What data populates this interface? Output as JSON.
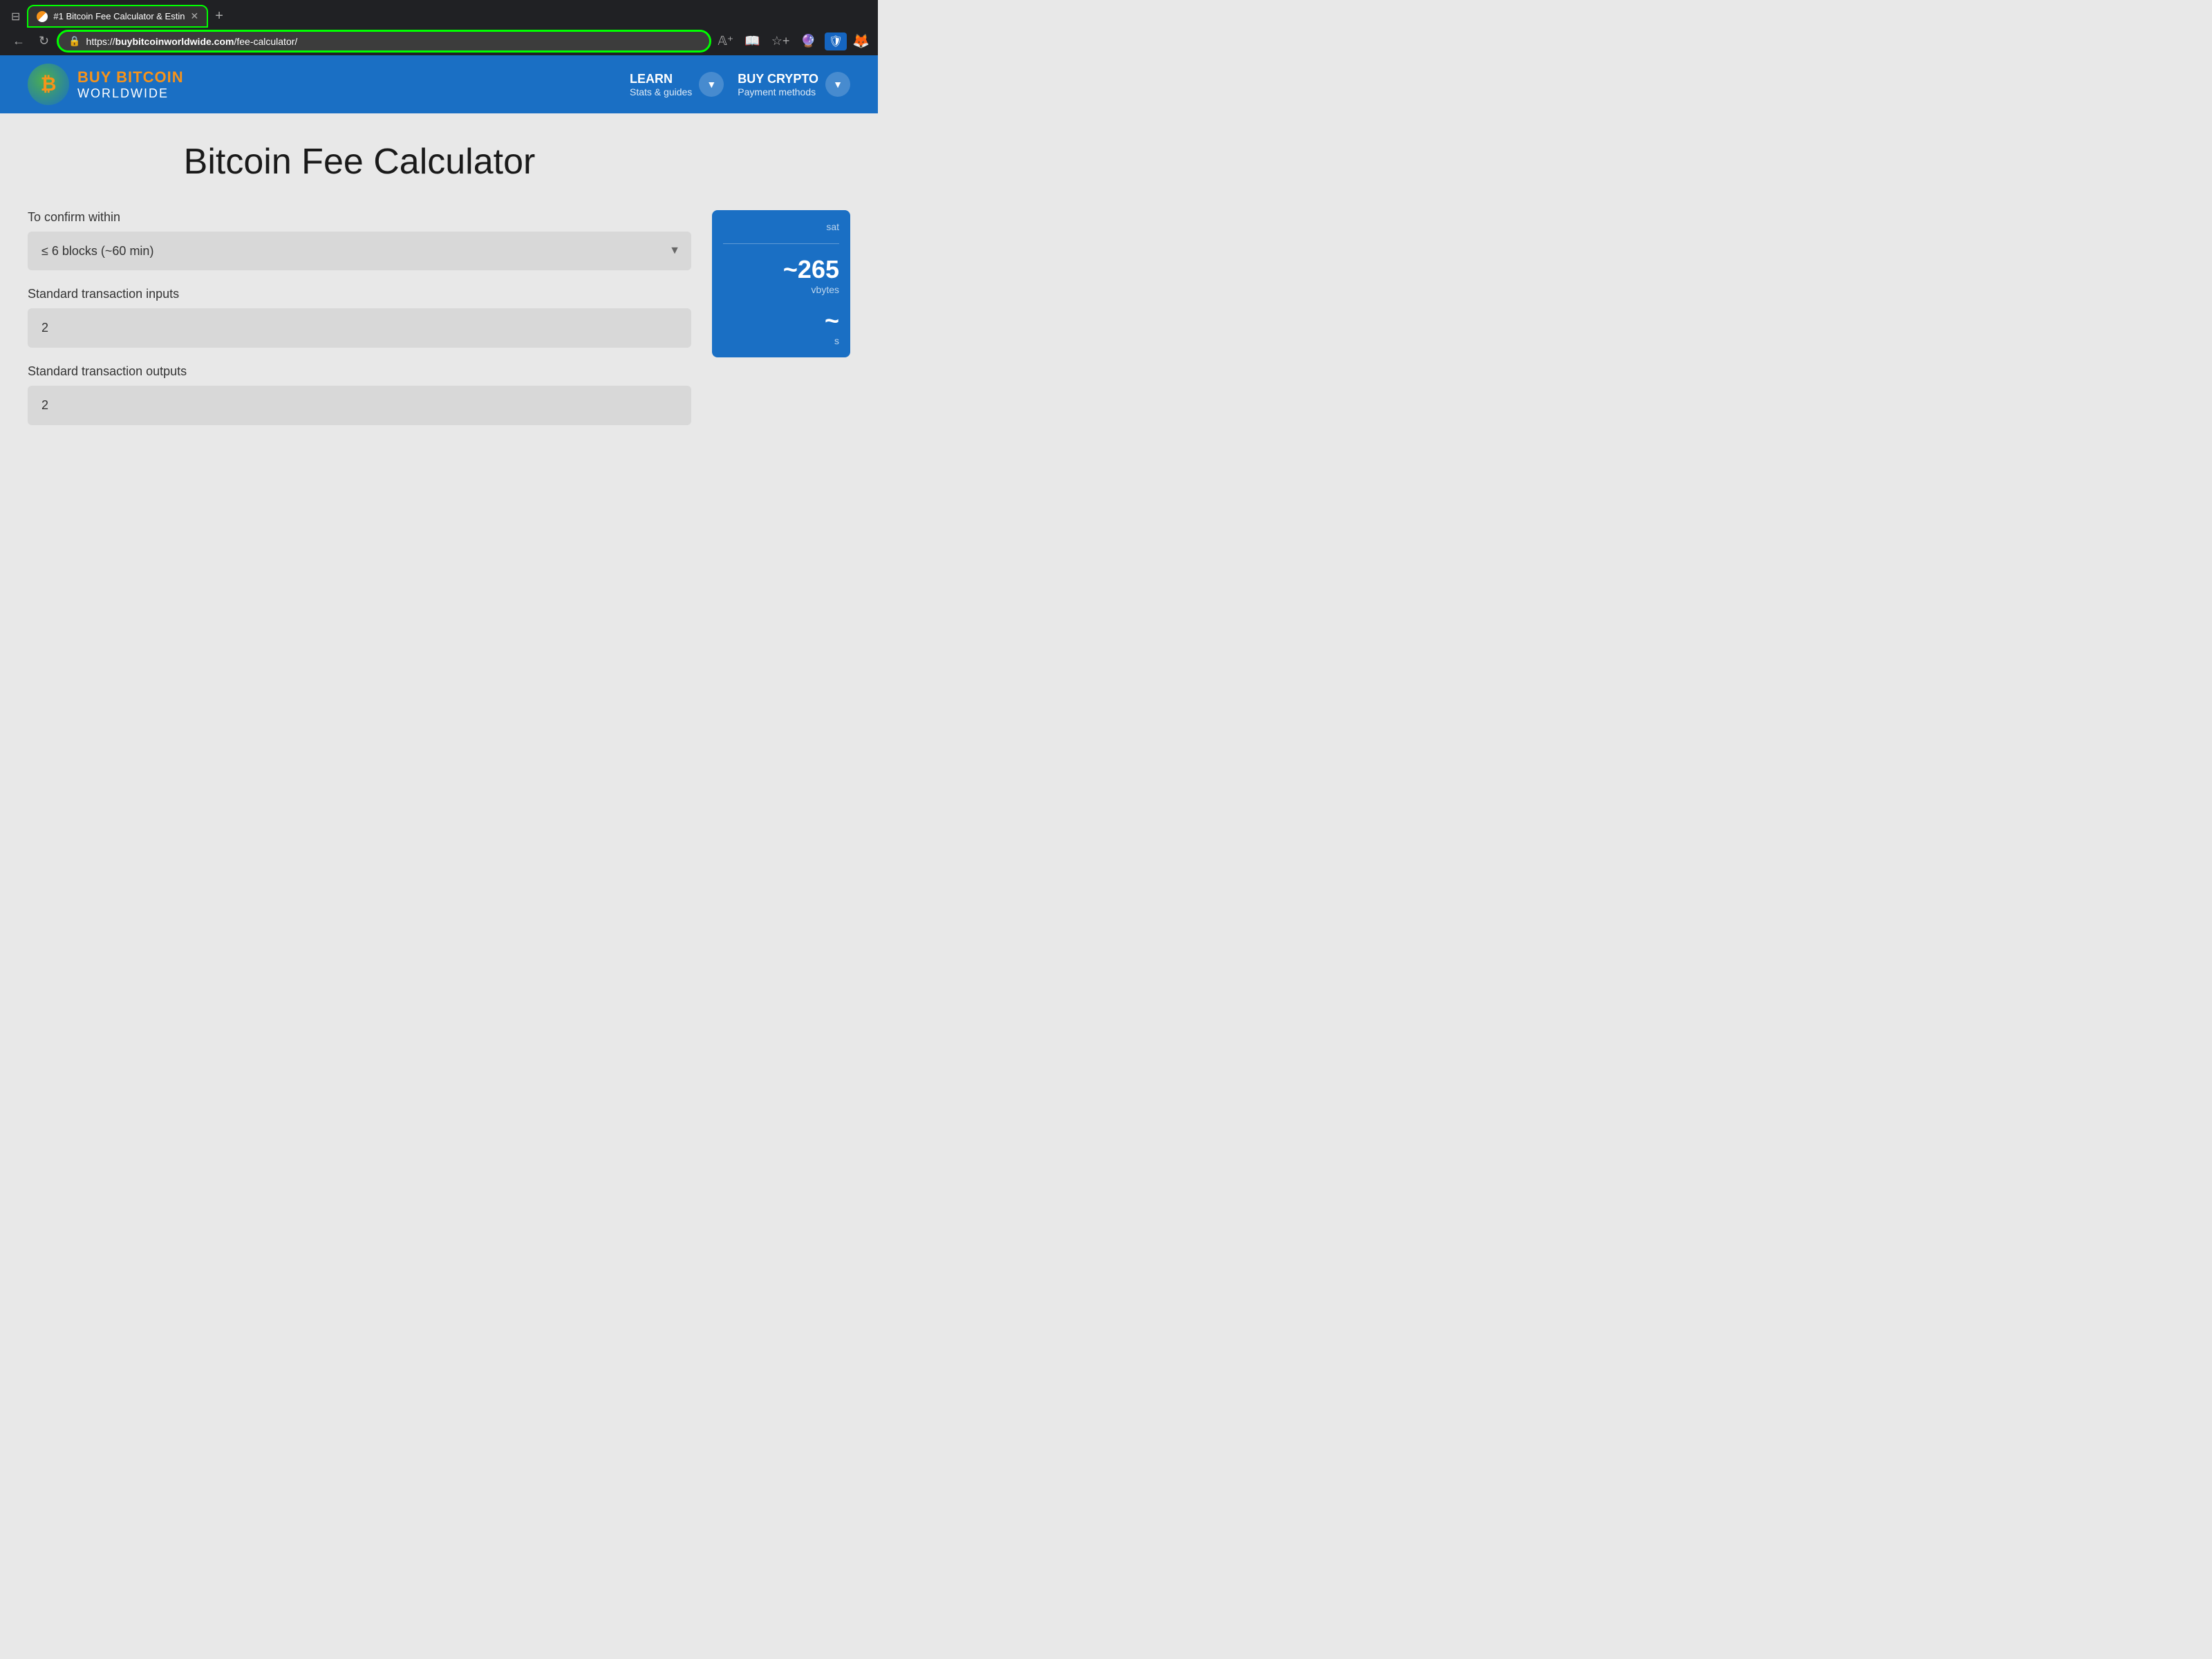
{
  "browser": {
    "tab_title": "#1 Bitcoin Fee Calculator & Estin",
    "url_display": "https://buybitcoinworldwide.com/fee-calculator/",
    "url_domain": "buybitcoinworldwide.com",
    "url_path": "/fee-calculator/",
    "url_protocol": "https://",
    "new_tab_label": "+"
  },
  "nav": {
    "logo_line1": "BUY BITCOIN",
    "logo_line2": "WORLDWIDE",
    "learn_title": "LEARN",
    "learn_sub": "Stats & guides",
    "buy_crypto_title": "BUY CRYPTO",
    "buy_crypto_sub": "Payment methods"
  },
  "main": {
    "page_title": "Bitcoin Fee Calculator",
    "confirm_label": "To confirm within",
    "confirm_value": "≤ 6 blocks (~60 min)",
    "inputs_label": "Standard transaction inputs",
    "inputs_value": "2",
    "outputs_label": "Standard transaction outputs",
    "outputs_value": "2",
    "result_vbytes": "~265",
    "result_vbytes_label": "vbytes",
    "result_sats": "~",
    "result_sats_label": "s",
    "result_unit": "sat"
  }
}
